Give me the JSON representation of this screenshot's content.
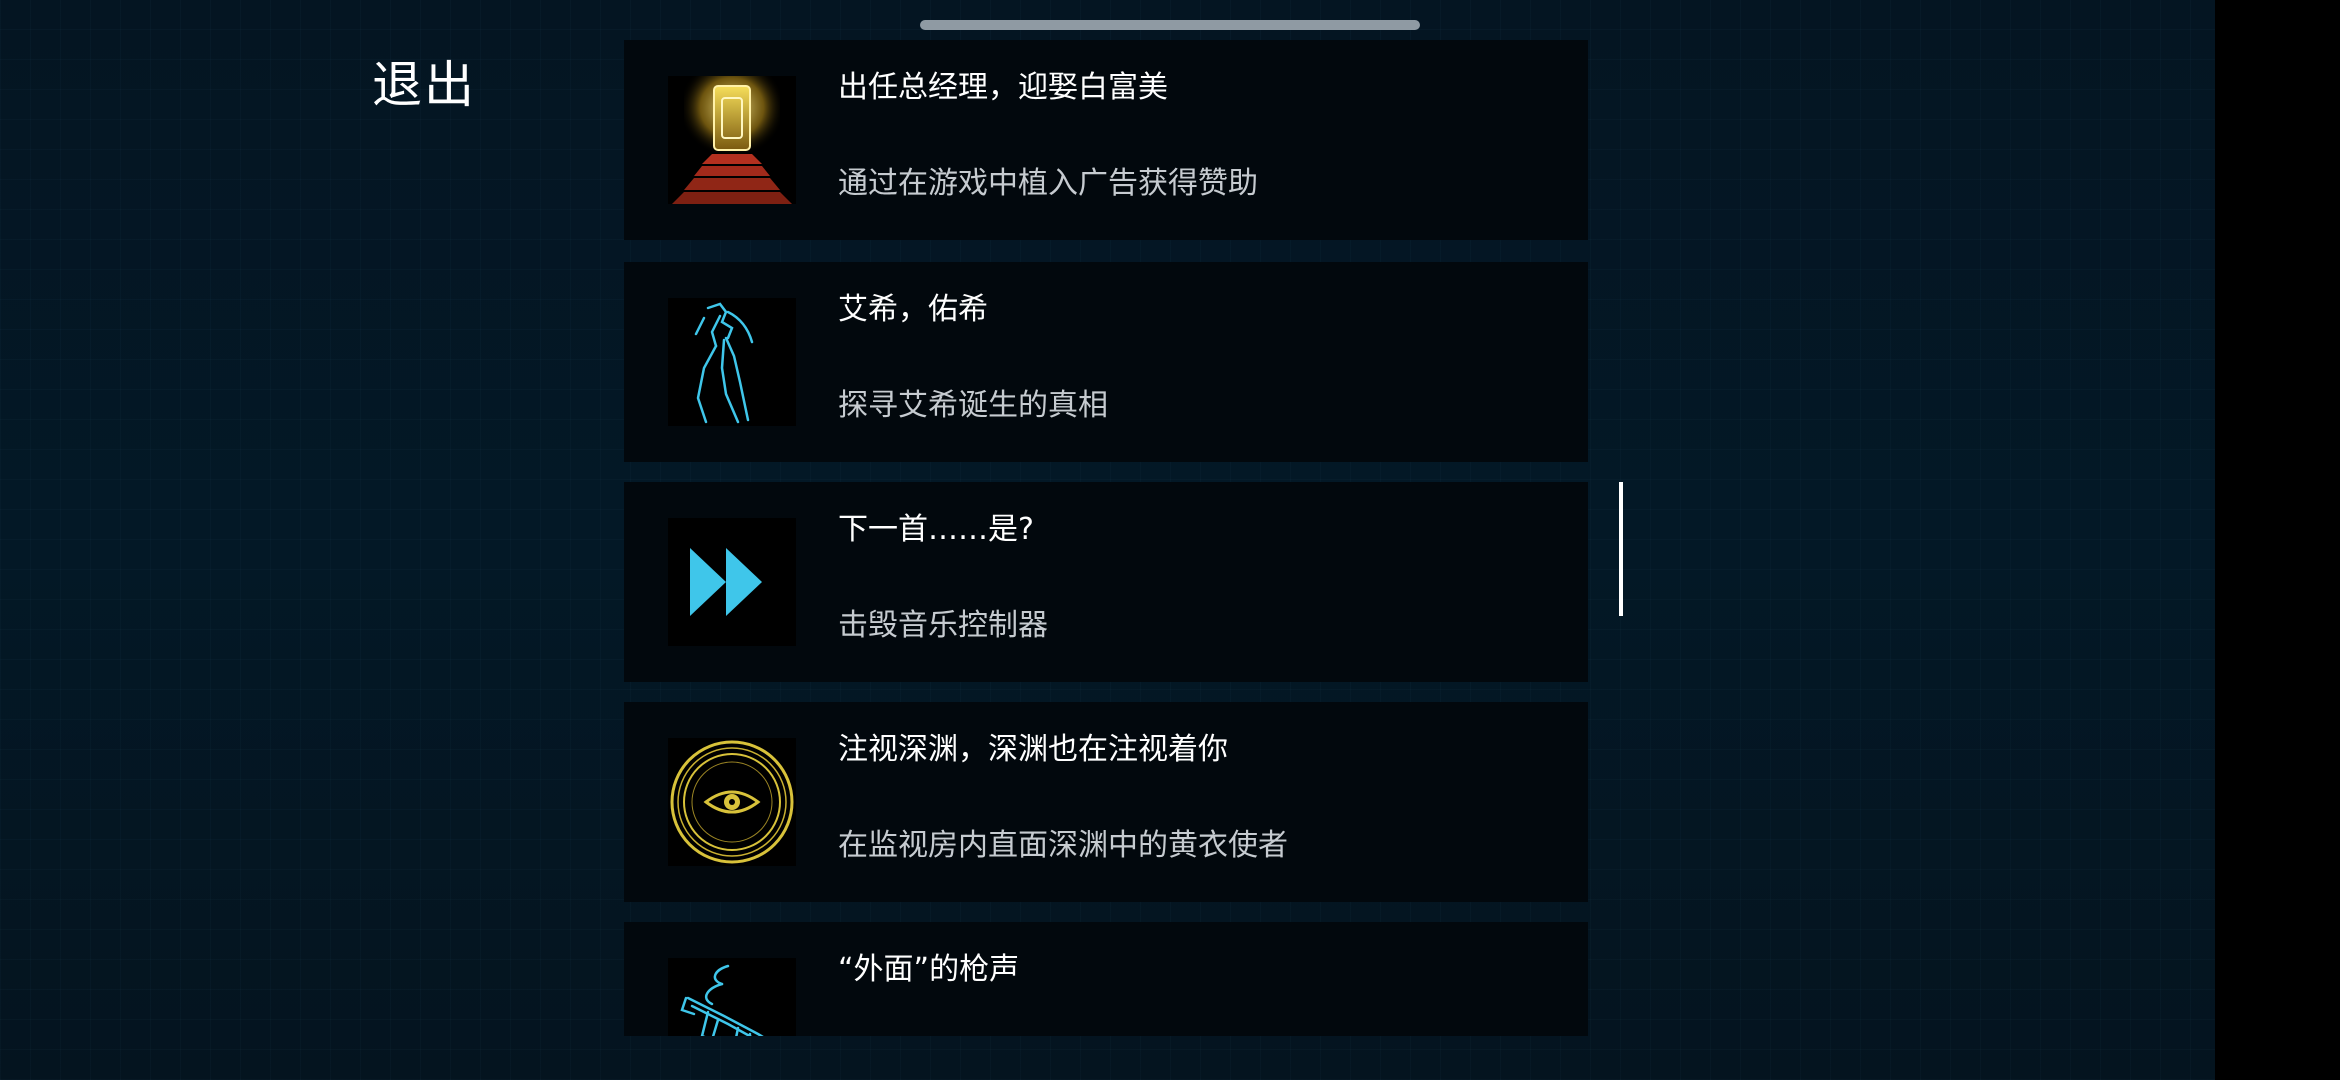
{
  "exit_label": "退出",
  "achievements": [
    {
      "title": "出任总经理，迎娶白富美",
      "desc": "通过在游戏中植入广告获得赞助",
      "icon": "golden-door-stairs-icon"
    },
    {
      "title": "艾希，佑希",
      "desc": "探寻艾希诞生的真相",
      "icon": "blue-scythe-figure-icon"
    },
    {
      "title": "下一首……是?",
      "desc": "击毁音乐控制器",
      "icon": "fast-forward-icon"
    },
    {
      "title": "注视深渊，深渊也在注视着你",
      "desc": "在监视房内直面深渊中的黄衣使者",
      "icon": "eye-circle-icon"
    },
    {
      "title": "“外面”的枪声",
      "desc": "",
      "icon": "blue-gun-icon"
    }
  ],
  "colors": {
    "background": "#041522",
    "card": "#02080d",
    "title": "#ffffff",
    "desc": "#c6cbd0",
    "cyan_accent": "#3fc6ea",
    "gold_accent": "#d8c23a"
  }
}
